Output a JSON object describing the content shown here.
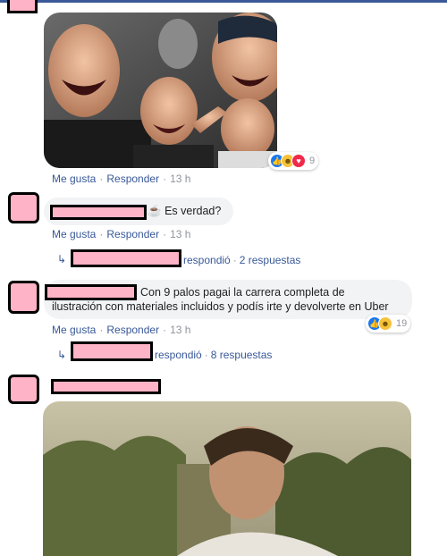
{
  "comments": [
    {
      "image_alt": "Reaction photo of a laughing man",
      "actions": {
        "like": "Me gusta",
        "reply": "Responder",
        "time": "13 h"
      },
      "reactions": {
        "count": "9",
        "icons": [
          "like-icon",
          "haha-icon",
          "love-icon"
        ]
      }
    },
    {
      "text": "Es verdad?",
      "text_icon": "☕",
      "actions": {
        "like": "Me gusta",
        "reply": "Responder",
        "time": "13 h"
      },
      "replies": {
        "verb": "respondió",
        "sep": "·",
        "count": "2 respuestas"
      }
    },
    {
      "text_line1": "Con 9 palos pagai la carrera completa de",
      "text_line2": "ilustración con materiales incluidos y podís irte y devolverte en Uber",
      "actions": {
        "like": "Me gusta",
        "reply": "Responder",
        "time": "13 h"
      },
      "reactions": {
        "count": "19",
        "icons": [
          "like-icon",
          "haha-icon"
        ]
      },
      "replies": {
        "verb": "respondió",
        "sep": "·",
        "count": "8 respuestas"
      }
    },
    {
      "image_alt": "Movie still of a man outdoors"
    }
  ],
  "colors": {
    "link": "#385898",
    "bubble": "#f2f3f5",
    "redaction": "#ffb3c6",
    "top_bar": "#3b5998"
  }
}
